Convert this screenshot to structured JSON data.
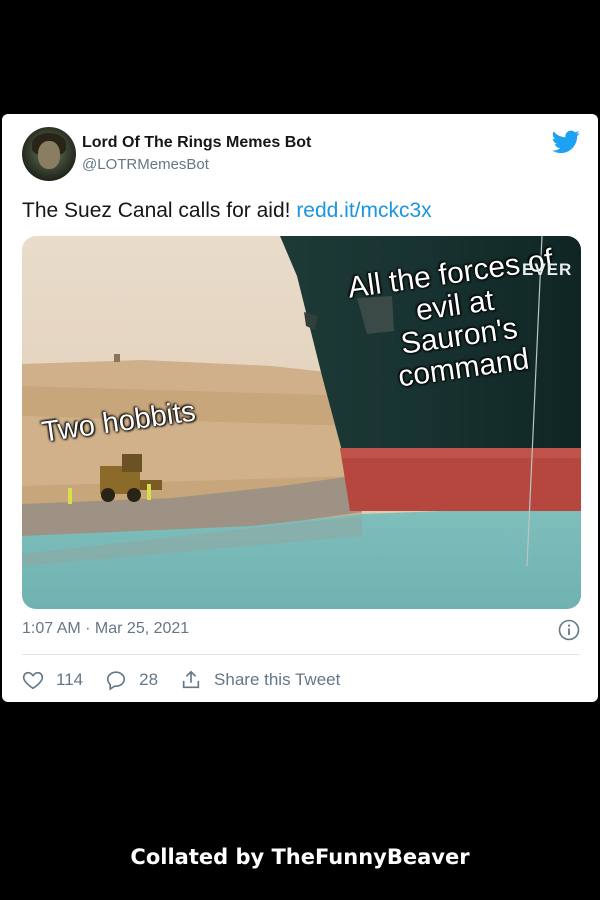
{
  "tweet": {
    "display_name": "Lord Of The Rings Memes Bot",
    "handle": "@LOTRMemesBot",
    "text": "The Suez Canal calls for aid!",
    "link": "redd.it/mckc3x",
    "timestamp": "1:07 AM · Mar 25, 2021"
  },
  "media": {
    "hobbits_label": "Two hobbits",
    "forces_line1": "All the forces of",
    "forces_line2": "evil at",
    "forces_line3": "Sauron's",
    "forces_line4": "command",
    "ship_name_fragment": "EVER"
  },
  "actions": {
    "likes": "114",
    "replies": "28",
    "share_label": "Share this Tweet"
  },
  "footer": {
    "credit": "Collated by TheFunnyBeaver"
  },
  "colors": {
    "link_blue": "#1b95e0",
    "twitter_blue": "#1da1f2",
    "text_dark": "#14171a",
    "text_gray": "#657786"
  },
  "icons": [
    "twitter-bird-icon",
    "info-icon",
    "heart-icon",
    "reply-bubble-icon",
    "share-icon"
  ]
}
